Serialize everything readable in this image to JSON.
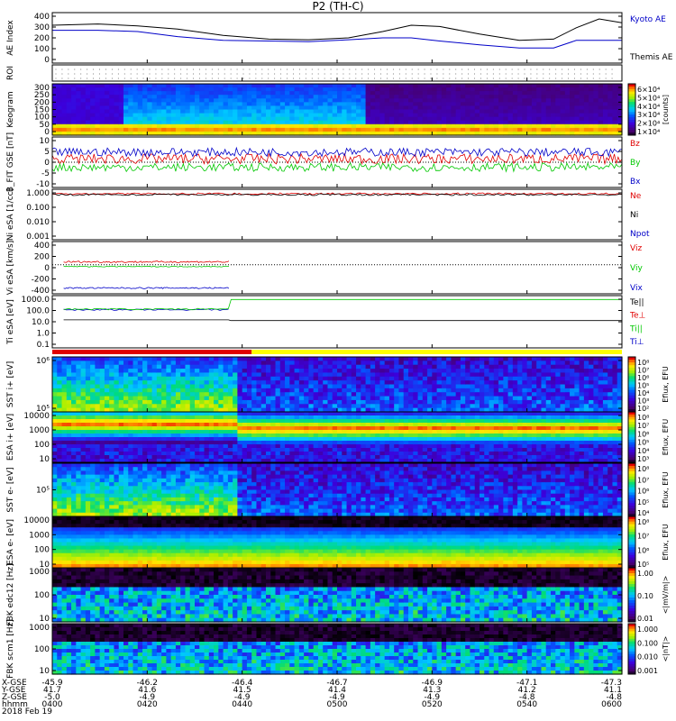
{
  "title": "P2 (TH-C)",
  "colors": {
    "black": "#000000",
    "blue": "#0000c8",
    "red": "#e00000",
    "green": "#00c800",
    "roi_bar_red": "#e00000",
    "roi_bar_yellow": "#ffff00"
  },
  "chart_data": [
    {
      "id": "ae",
      "type": "line",
      "ylabel": "AE Index",
      "ylim": [
        0,
        400
      ],
      "yticks": [
        "400",
        "300",
        "200",
        "100",
        "0"
      ],
      "legend": [
        {
          "label": "Kyoto AE",
          "color": "#0000c8"
        },
        {
          "label": "Themis AE",
          "color": "#000000"
        }
      ],
      "series": [
        {
          "name": "Kyoto AE",
          "color": "#0000c8",
          "x": [
            0,
            0.08,
            0.15,
            0.22,
            0.3,
            0.38,
            0.45,
            0.52,
            0.58,
            0.63,
            0.68,
            0.75,
            0.82,
            0.88,
            0.92,
            0.96,
            1
          ],
          "values": [
            260,
            260,
            250,
            210,
            180,
            175,
            170,
            185,
            200,
            200,
            175,
            145,
            120,
            120,
            180,
            180,
            180
          ]
        },
        {
          "name": "Themis AE",
          "color": "#000000",
          "x": [
            0,
            0.08,
            0.15,
            0.22,
            0.3,
            0.38,
            0.45,
            0.52,
            0.58,
            0.63,
            0.68,
            0.75,
            0.82,
            0.88,
            0.92,
            0.96,
            1
          ],
          "values": [
            300,
            310,
            295,
            270,
            220,
            190,
            185,
            200,
            250,
            300,
            290,
            230,
            180,
            190,
            280,
            350,
            320
          ]
        }
      ]
    },
    {
      "id": "roi",
      "type": "scatter",
      "ylabel": "ROI",
      "ylim": [
        0,
        1
      ],
      "yticks": []
    },
    {
      "id": "keogram",
      "type": "heatmap",
      "ylabel": "Keogram",
      "ylim": [
        0,
        300
      ],
      "yticks": [
        "300",
        "250",
        "200",
        "150",
        "100",
        "50",
        "0"
      ],
      "colorbar": {
        "label": "[counts]",
        "ticks": [
          "6×10⁴",
          "5×10⁴",
          "4×10⁴",
          "3×10⁴",
          "2×10⁴",
          "1×10⁴"
        ]
      }
    },
    {
      "id": "bfield",
      "type": "line",
      "ylabel": "B_FIT GSE [nT]",
      "ylim": [
        -15,
        15
      ],
      "yticks": [
        "10",
        "5",
        "0",
        "-5",
        "-10"
      ],
      "legend": [
        {
          "label": "Bz",
          "color": "#e00000"
        },
        {
          "label": "By",
          "color": "#00c800"
        },
        {
          "label": "Bx",
          "color": "#0000c8"
        }
      ],
      "series": [
        {
          "name": "Bz",
          "color": "#e00000",
          "base": 2,
          "noise": 3
        },
        {
          "name": "By",
          "color": "#00c800",
          "base": -3,
          "noise": 2.5
        },
        {
          "name": "Bx",
          "color": "#0000c8",
          "base": 6,
          "noise": 2.5
        }
      ]
    },
    {
      "id": "density",
      "type": "line",
      "ylabel": "Ni eSA [1/cc]",
      "log": true,
      "ylim": [
        0.001,
        10
      ],
      "yticks": [
        "1.000",
        "0.100",
        "0.010",
        "0.001"
      ],
      "legend": [
        {
          "label": "Ne",
          "color": "#e00000"
        },
        {
          "label": "Ni",
          "color": "#000000"
        },
        {
          "label": "Npot",
          "color": "#0000c8"
        }
      ]
    },
    {
      "id": "velocity",
      "type": "line",
      "ylabel": "Vi eSA [km/s]",
      "ylim": [
        -500,
        400
      ],
      "yticks": [
        "400",
        "200",
        "0",
        "-200",
        "-400"
      ],
      "legend": [
        {
          "label": "Viz",
          "color": "#e00000"
        },
        {
          "label": "Viy",
          "color": "#00c800"
        },
        {
          "label": "Vix",
          "color": "#0000c8"
        }
      ],
      "series": [
        {
          "name": "Viz",
          "color": "#e00000",
          "end": 0.31,
          "base": 50,
          "noise": 15
        },
        {
          "name": "Viy",
          "color": "#00c800",
          "end": 0.31,
          "base": -30,
          "noise": 8
        },
        {
          "name": "Vix",
          "color": "#0000c8",
          "end": 0.31,
          "base": -400,
          "noise": 12
        }
      ]
    },
    {
      "id": "temperature",
      "type": "line",
      "ylabel": "Ti eSA [eV]",
      "log": true,
      "ylim": [
        0.1,
        3000
      ],
      "yticks": [
        "1000.0",
        "100.0",
        "10.0",
        "1.0",
        "0.1"
      ],
      "legend": [
        {
          "label": "Te||",
          "color": "#000000"
        },
        {
          "label": "Te⊥",
          "color": "#e00000"
        },
        {
          "label": "Ti||",
          "color": "#00c800"
        },
        {
          "label": "Ti⊥",
          "color": "#0000c8"
        }
      ]
    },
    {
      "id": "sst_ion",
      "type": "heatmap",
      "ylabel": "SST i+ [eV]",
      "yticks": [
        "10⁶",
        "10⁵"
      ],
      "colorbar": {
        "label": "Eflux, EFU",
        "ticks": [
          "10⁸",
          "10⁷",
          "10⁶",
          "10⁵",
          "10⁴",
          "10³",
          "10²"
        ]
      }
    },
    {
      "id": "esa_ion",
      "type": "heatmap",
      "ylabel": "ESA i+ [eV]",
      "yticks": [
        "10000",
        "1000",
        "100",
        "10"
      ],
      "colorbar": {
        "label": "Eflux, EFU",
        "ticks": [
          "10⁸",
          "10⁷",
          "10⁶",
          "10⁵",
          "10⁴",
          "10³"
        ]
      }
    },
    {
      "id": "sst_electron",
      "type": "heatmap",
      "ylabel": "SST e- [eV]",
      "yticks": [
        "10⁵"
      ],
      "colorbar": {
        "label": "Eflux, EFU",
        "ticks": [
          "10⁸",
          "10⁷",
          "10⁶",
          "10⁵",
          "10⁴"
        ]
      }
    },
    {
      "id": "esa_electron",
      "type": "heatmap",
      "ylabel": "ESA e- [eV]",
      "yticks": [
        "10000",
        "1000",
        "100",
        "10"
      ],
      "colorbar": {
        "label": "Eflux, EFU",
        "ticks": [
          "10⁸",
          "10⁷",
          "10⁶",
          "10⁵"
        ]
      }
    },
    {
      "id": "fbk_edc",
      "type": "heatmap",
      "ylabel": "FBK edc12 [Hz]",
      "yticks": [
        "1000",
        "100",
        "10"
      ],
      "colorbar": {
        "label": "<|mV/m|>",
        "ticks": [
          "1.00",
          "0.10",
          "0.01"
        ]
      }
    },
    {
      "id": "fbk_scm",
      "type": "heatmap",
      "ylabel": "FBK scm1 [Hz]",
      "yticks": [
        "1000",
        "100",
        "10"
      ],
      "colorbar": {
        "label": "<|nT|>",
        "ticks": [
          "1.000",
          "0.100",
          "0.010",
          "0.001"
        ]
      }
    }
  ],
  "orbit_table": {
    "row_labels": [
      "X-GSE",
      "Y-GSE",
      "Z-GSE",
      "hhmm",
      "2018 Feb 19"
    ],
    "columns": [
      {
        "values": [
          "-45.9",
          "41.7",
          "-5.0",
          "0400"
        ]
      },
      {
        "values": [
          "-46.2",
          "41.6",
          "-4.9",
          "0420"
        ]
      },
      {
        "values": [
          "-46.4",
          "41.5",
          "-4.9",
          "0440"
        ]
      },
      {
        "values": [
          "-46.7",
          "41.4",
          "-4.9",
          "0500"
        ]
      },
      {
        "values": [
          "-46.9",
          "41.3",
          "-4.9",
          "0520"
        ]
      },
      {
        "values": [
          "-47.1",
          "41.2",
          "-4.8",
          "0540"
        ]
      },
      {
        "values": [
          "-47.3",
          "41.1",
          "-4.8",
          "0600"
        ]
      }
    ]
  }
}
